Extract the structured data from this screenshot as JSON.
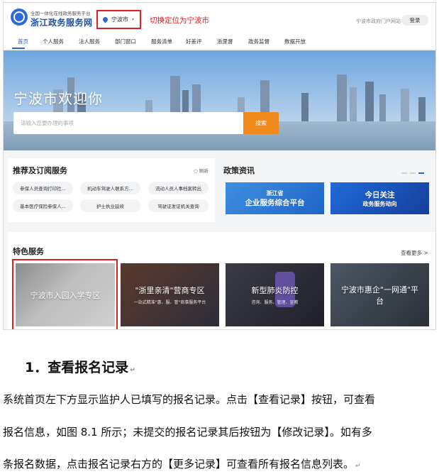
{
  "header": {
    "logo_sub": "全国一体化在线政务服务平台",
    "logo_main": "浙江政务服务网",
    "city": "宁波市",
    "caret": "▾",
    "annotation": "切换定位为宁波市",
    "portal_link": "宁波市政府门户网站",
    "login": "登录"
  },
  "nav": {
    "items": [
      "首页",
      "个人服务",
      "法人服务",
      "部门窗口",
      "服务清单",
      "好差评",
      "浙里督",
      "政务监督",
      "数据开放"
    ],
    "active_index": 0
  },
  "banner": {
    "title": "宁波市欢迎你",
    "search_placeholder": "请输入您要办理的事项",
    "search_button": "搜索"
  },
  "recommend": {
    "title": "推荐及订阅服务",
    "refresh": "刷新",
    "items": [
      "参保人员查询打印社...",
      "机动车驾驶人联系方...",
      "流动人员人事档案转出",
      "基本医疗保险参保人...",
      "护士执业延续",
      "驾驶证发证机关查询"
    ]
  },
  "policy": {
    "title": "政策资讯",
    "banners": [
      {
        "line1": "浙江省",
        "line2": "企业服务综合平台"
      },
      {
        "line1": "今日关注",
        "line2": "政务服务动向"
      }
    ]
  },
  "featured": {
    "title": "特色服务",
    "more": "查看更多 >",
    "items": [
      {
        "title": "宁波市入园入学专区",
        "sub": ""
      },
      {
        "title": "\"浙里亲清\"营商专区",
        "sub": "一站式精准\"惠、服、管\"商事服务平台"
      },
      {
        "title": "新型肺炎防控",
        "sub": "咨询、服务、管理、宣教"
      },
      {
        "title": "宁波市惠企\"一网通\"平台",
        "sub": ""
      }
    ]
  },
  "doc": {
    "heading": "1．查看报名记录",
    "paragraph_lines": [
      "系统首页左下方显示监护人已填写的报名记录。点击【查看记录】按钮，可查看",
      "报名信息，如图 8.1 所示；未提交的报名记录其后按钮为【修改记录】。如有多",
      "条报名数据，点击报名记录右方的【更多记录】可查看所有报名信息列表。"
    ],
    "return_mark": "↵"
  },
  "colors": {
    "brand_blue": "#2b6bd3",
    "annotation_red": "#e02020",
    "search_orange": "#f08a1c"
  }
}
